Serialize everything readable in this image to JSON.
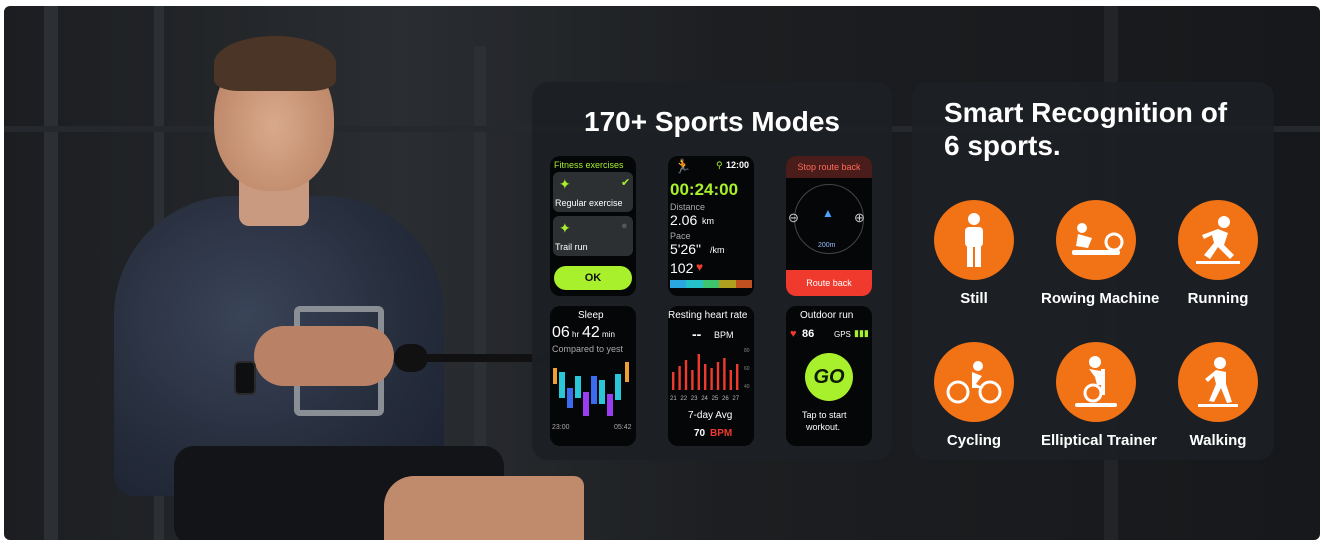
{
  "sports_modes": {
    "title": "170+ Sports Modes",
    "fitness": {
      "header": "Fitness exercises",
      "item1": "Regular exercise",
      "item2": "Trail run",
      "ok": "OK"
    },
    "timer": {
      "time": "12:00",
      "elapsed": "00:24:00",
      "distance_label": "Distance",
      "distance_value": "2.06",
      "distance_unit": "km",
      "pace_label": "Pace",
      "pace_value": "5'26\"",
      "pace_unit": "/km",
      "heart": "102"
    },
    "route": {
      "header": "Stop route back",
      "footer": "Route back",
      "scale": "200m"
    },
    "sleep": {
      "title": "Sleep",
      "hours": "06",
      "hr_unit": "hr",
      "minutes": "42",
      "min_unit": "min",
      "compare": "Compared to yest",
      "start": "23:00",
      "end": "05:42"
    },
    "heart_rate": {
      "title": "Resting heart rate",
      "value": "--",
      "unit": "BPM",
      "avg_label": "7-day Avg",
      "avg_value": "70",
      "avg_unit": "BPM",
      "days": [
        "21",
        "22",
        "23",
        "24",
        "25",
        "26",
        "27"
      ],
      "ticks": [
        "80",
        "60",
        "40"
      ]
    },
    "outdoor": {
      "title": "Outdoor run",
      "heart": "86",
      "gps": "GPS",
      "go": "GO",
      "tap": "Tap to start",
      "workout": "workout."
    }
  },
  "smart_recognition": {
    "title_line1": "Smart Recognition of",
    "title_line2": "6 sports.",
    "sports": [
      {
        "label": "Still",
        "icon": "standing-person-icon"
      },
      {
        "label": "Rowing Machine",
        "icon": "rowing-machine-icon"
      },
      {
        "label": "Running",
        "icon": "running-person-icon"
      },
      {
        "label": "Cycling",
        "icon": "cycling-icon"
      },
      {
        "label": "Elliptical Trainer",
        "icon": "elliptical-trainer-icon"
      },
      {
        "label": "Walking",
        "icon": "walking-person-icon"
      }
    ]
  },
  "colors": {
    "accent_orange": "#f27216",
    "accent_green": "#a8f02c",
    "alert_red": "#f03a2e"
  }
}
